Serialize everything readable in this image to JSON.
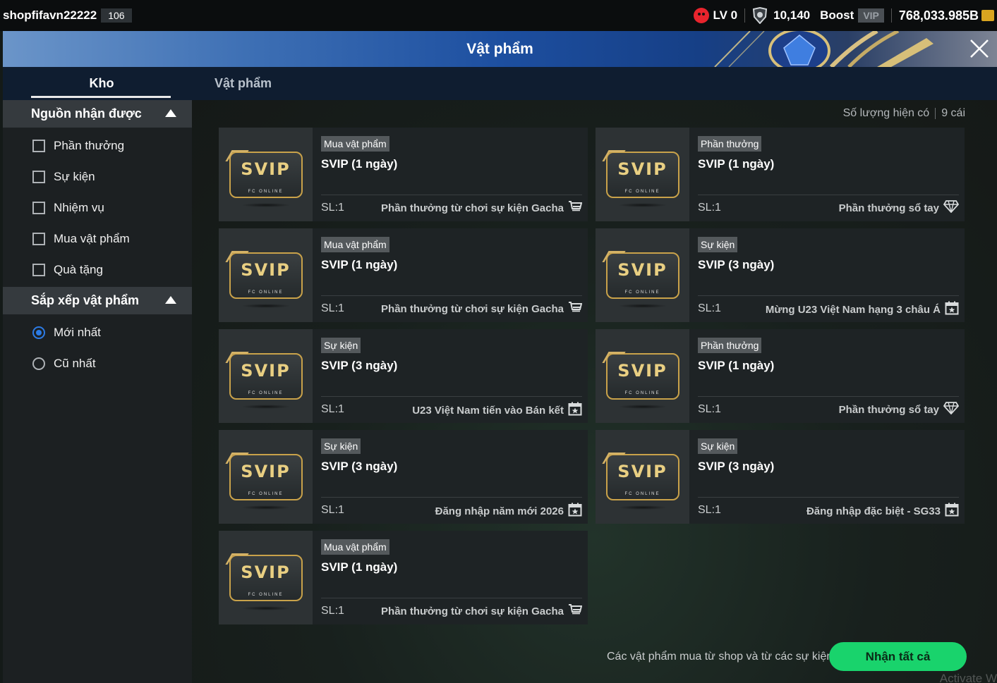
{
  "topbar": {
    "username": "shopfifavn22222",
    "user_level": "106",
    "lv_label": "LV 0",
    "coins": "10,140",
    "boost_label": "Boost",
    "vip_label": "VIP",
    "bp": "768,033.985B"
  },
  "header": {
    "title": "Vật phẩm"
  },
  "tabs": [
    {
      "label": "Kho",
      "active": true
    },
    {
      "label": "Vật phẩm",
      "active": false
    }
  ],
  "sidebar": {
    "source_section": {
      "title": "Nguồn nhận được",
      "options": [
        {
          "label": "Phần thưởng",
          "checked": false
        },
        {
          "label": "Sự kiện",
          "checked": false
        },
        {
          "label": "Nhiệm vụ",
          "checked": false
        },
        {
          "label": "Mua vật phẩm",
          "checked": false
        },
        {
          "label": "Quà tặng",
          "checked": false
        }
      ]
    },
    "sort_section": {
      "title": "Sắp xếp vật phẩm",
      "options": [
        {
          "label": "Mới nhất",
          "selected": true
        },
        {
          "label": "Cũ nhất",
          "selected": false
        }
      ]
    }
  },
  "main": {
    "count_label": "Số lượng hiện có",
    "count_value": "9 cái",
    "logo_text": "SVIP",
    "logo_sub": "FC ONLINE",
    "items": [
      {
        "tag": "Mua vật phẩm",
        "name": "SVIP (1 ngày)",
        "qty": "SL:1",
        "source": "Phần thưởng từ chơi sự kiện Gacha",
        "icon": "cart-icon"
      },
      {
        "tag": "Phần thưởng",
        "name": "SVIP (1 ngày)",
        "qty": "SL:1",
        "source": "Phần thưởng sổ tay",
        "icon": "diamond-icon"
      },
      {
        "tag": "Mua vật phẩm",
        "name": "SVIP (1 ngày)",
        "qty": "SL:1",
        "source": "Phần thưởng từ chơi sự kiện Gacha",
        "icon": "cart-icon"
      },
      {
        "tag": "Sự kiện",
        "name": "SVIP (3 ngày)",
        "qty": "SL:1",
        "source": "Mừng U23 Việt Nam hạng 3 châu Á",
        "icon": "calendar-icon"
      },
      {
        "tag": "Sự kiện",
        "name": "SVIP (3 ngày)",
        "qty": "SL:1",
        "source": "U23 Việt Nam tiến vào Bán kết",
        "icon": "calendar-icon"
      },
      {
        "tag": "Phần thưởng",
        "name": "SVIP (1 ngày)",
        "qty": "SL:1",
        "source": "Phần thưởng sổ tay",
        "icon": "diamond-icon"
      },
      {
        "tag": "Sự kiện",
        "name": "SVIP (3 ngày)",
        "qty": "SL:1",
        "source": "Đăng nhập năm mới 2026",
        "icon": "calendar-icon"
      },
      {
        "tag": "Sự kiện",
        "name": "SVIP (3 ngày)",
        "qty": "SL:1",
        "source": "Đăng nhập đặc biệt - SG33",
        "icon": "calendar-icon"
      },
      {
        "tag": "Mua vật phẩm",
        "name": "SVIP (1 ngày)",
        "qty": "SL:1",
        "source": "Phần thưởng từ chơi sự kiện Gacha",
        "icon": "cart-icon"
      }
    ],
    "footer_note": "Các vật phẩm mua từ shop và từ các sự kiện.",
    "claim_all_label": "Nhận tất cả",
    "watermark": "Activate W"
  },
  "colors": {
    "accent_green": "#19d36c",
    "banner_blue": "#1d4fa0",
    "radio_blue": "#2c7be5",
    "gold": "#e9cf82"
  }
}
